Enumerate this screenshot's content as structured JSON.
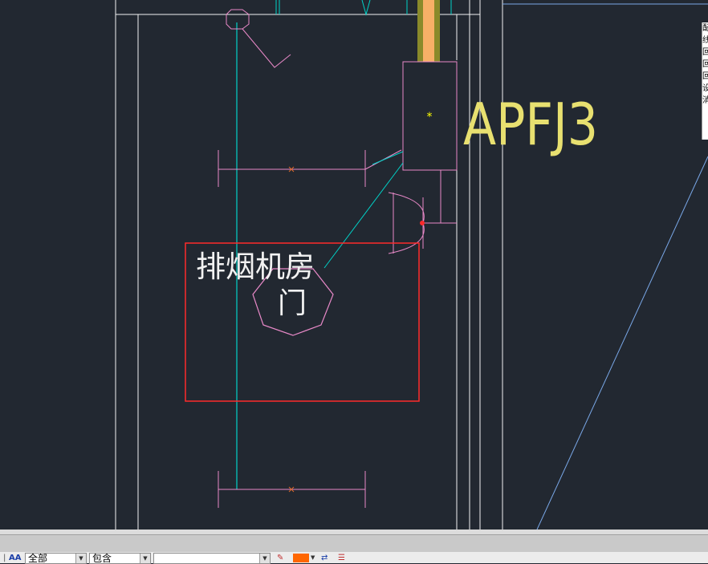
{
  "drawing": {
    "room_label": "排烟机房",
    "room_sublabel": "门",
    "equipment_tag": "APFJ3"
  },
  "properties_panel": {
    "chars": [
      "配",
      "线",
      "回",
      "回",
      "回",
      "设",
      "消"
    ]
  },
  "toolbar": {
    "layer_filter": {
      "value": "全部"
    },
    "match_mode": {
      "value": "包含"
    },
    "search_text": {
      "value": ""
    }
  },
  "colors": {
    "background": "#222831",
    "wall": "#f2f2f2",
    "cyan": "#00d2c8",
    "magenta": "#e889c8",
    "yellow_text": "#e8e070",
    "red_selection": "#ff2a2a",
    "blue_line": "#7aa8e8",
    "swatch": "#ff6600"
  }
}
